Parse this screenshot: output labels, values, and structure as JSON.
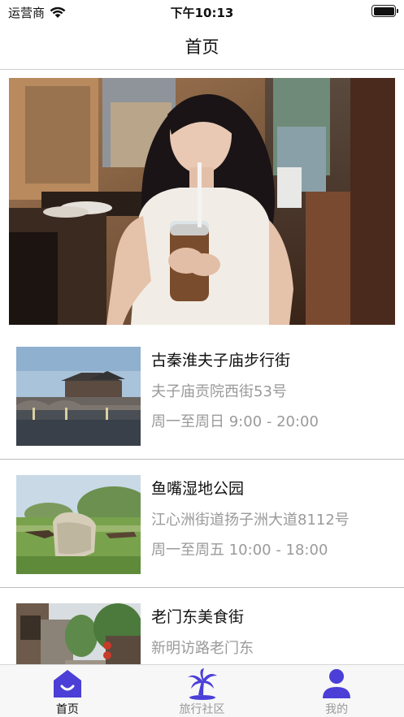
{
  "status_bar": {
    "carrier": "运营商",
    "time": "下午10:13",
    "wifi_icon": "wifi-icon",
    "battery_icon": "battery-icon"
  },
  "nav": {
    "title": "首页"
  },
  "banner": {
    "image": "woman-drinking-iced-tea-photo"
  },
  "places": [
    {
      "title": "古秦淮夫子庙步行街",
      "address": "夫子庙贡院西街53号",
      "hours": "周一至周日 9:00 - 20:00",
      "image": "qinhuai-river-bridge-photo"
    },
    {
      "title": "鱼嘴湿地公园",
      "address": "江心洲街道扬子洲大道8112号",
      "hours": "周一至周五 10:00 - 18:00",
      "image": "wetland-park-stone-photo"
    },
    {
      "title": "老门东美食街",
      "address": "新明访路老门东",
      "hours": "",
      "image": "old-street-alley-photo"
    }
  ],
  "tabs": [
    {
      "label": "首页",
      "icon": "home-icon",
      "active": true
    },
    {
      "label": "旅行社区",
      "icon": "palm-tree-icon",
      "active": false
    },
    {
      "label": "我的",
      "icon": "user-icon",
      "active": false
    }
  ],
  "colors": {
    "accent": "#4b3fd8",
    "inactive_icon": "#4b3fd8",
    "secondary_text": "#9a9a9a",
    "divider": "#bdbdbd"
  }
}
